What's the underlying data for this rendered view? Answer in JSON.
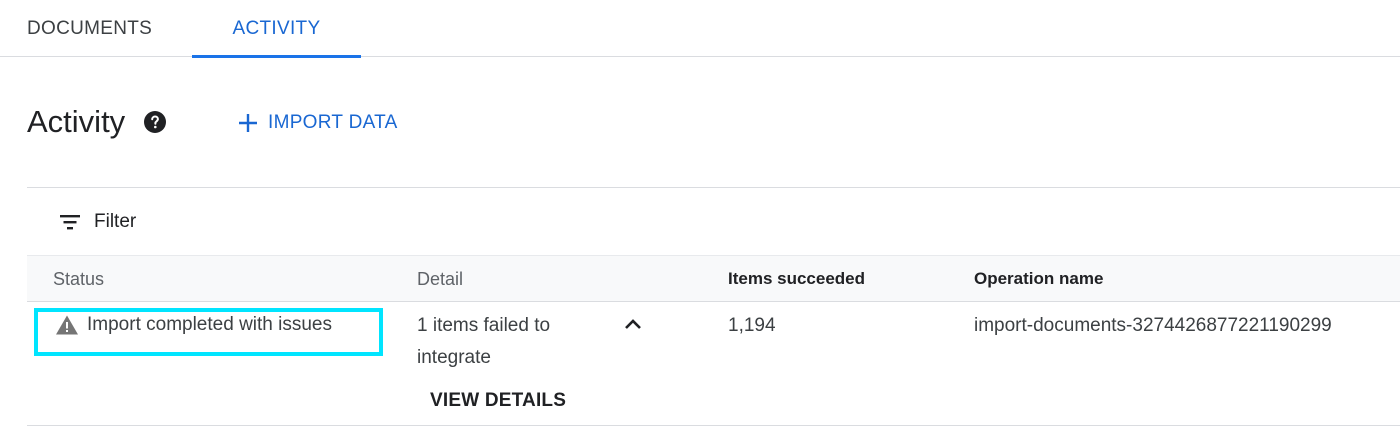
{
  "tabs": [
    {
      "label": "DOCUMENTS",
      "active": false
    },
    {
      "label": "ACTIVITY",
      "active": true
    }
  ],
  "header": {
    "title": "Activity",
    "help_icon": "help-circle-icon",
    "import_label": "IMPORT DATA",
    "import_icon": "plus-icon"
  },
  "filter": {
    "label": "Filter",
    "icon": "filter-lines-icon"
  },
  "table": {
    "columns": [
      "Status",
      "Detail",
      "Items succeeded",
      "Operation name"
    ],
    "rows": [
      {
        "status": "Import completed with issues",
        "status_icon": "warning-icon",
        "detail": "1 items failed to integrate",
        "detail_action": "VIEW DETAILS",
        "expand_icon": "chevron-up-icon",
        "items_succeeded": "1,194",
        "operation_name": "import-documents-3274426877221190299"
      }
    ]
  },
  "colors": {
    "accent": "#1a73e8",
    "highlight": "#00e5ff",
    "warning_icon": "#757575"
  }
}
